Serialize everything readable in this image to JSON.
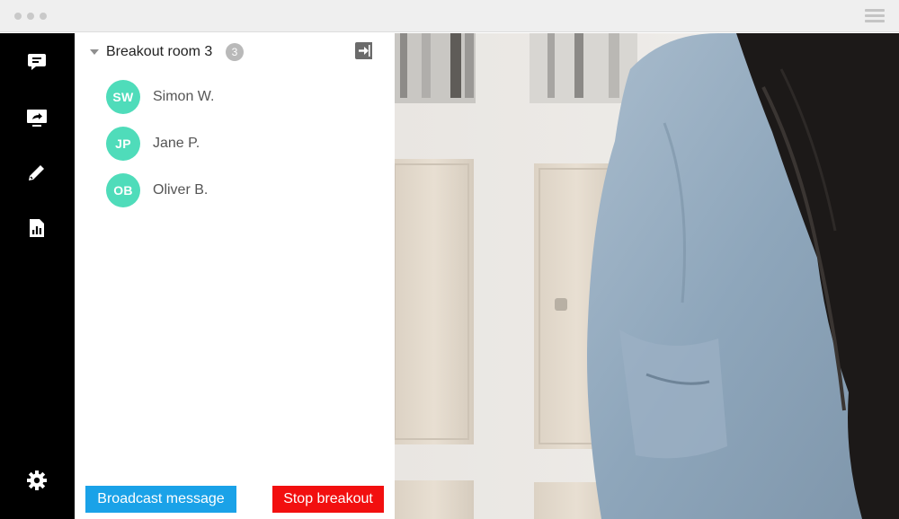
{
  "sidebar": {
    "items": [
      {
        "icon": "chat-icon"
      },
      {
        "icon": "screen-share-icon"
      },
      {
        "icon": "pencil-icon"
      },
      {
        "icon": "report-icon"
      },
      {
        "icon": "gear-icon"
      }
    ]
  },
  "room": {
    "title": "Breakout room 3",
    "participant_count": "3"
  },
  "participants": [
    {
      "initials": "SW",
      "name": "Simon W."
    },
    {
      "initials": "JP",
      "name": "Jane P."
    },
    {
      "initials": "OB",
      "name": "Oliver B."
    }
  ],
  "actions": {
    "broadcast_label": "Broadcast message",
    "stop_label": "Stop breakout"
  },
  "colors": {
    "avatar": "#4fdcba",
    "broadcast": "#1aa2e8",
    "stop": "#f20f0f",
    "rail": "#000000"
  }
}
